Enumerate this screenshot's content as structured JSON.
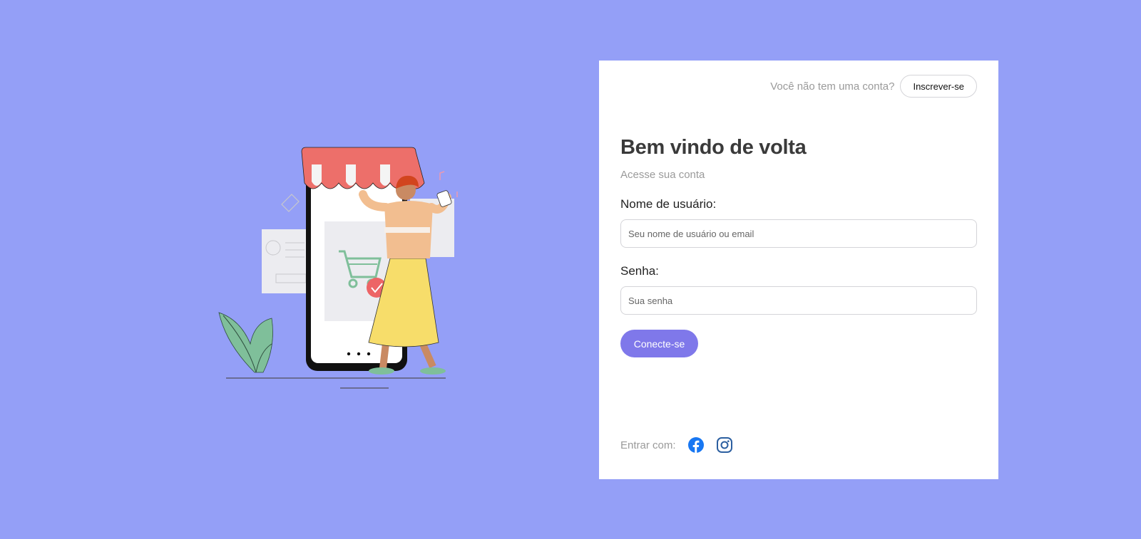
{
  "header": {
    "no_account_text": "Você não tem uma conta?",
    "signup_label": "Inscrever-se"
  },
  "form": {
    "title": "Bem vindo de volta",
    "subtitle": "Acesse sua conta",
    "username_label": "Nome de usuário:",
    "username_placeholder": "Seu nome de usuário ou email",
    "password_label": "Senha:",
    "password_placeholder": "Sua senha",
    "submit_label": "Conecte-se"
  },
  "social": {
    "label": "Entrar com:",
    "icons": [
      "facebook-icon",
      "instagram-icon"
    ]
  },
  "colors": {
    "background": "#949ff7",
    "accent": "#7f78ea",
    "facebook": "#1877f2",
    "instagram": "#2c5fa0"
  }
}
